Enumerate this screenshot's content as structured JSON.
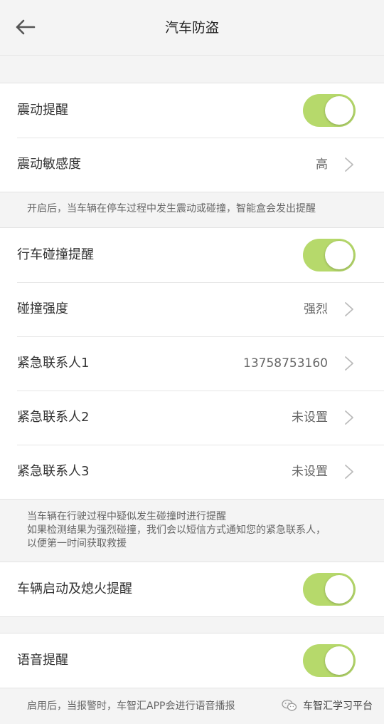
{
  "header": {
    "title": "汽车防盗"
  },
  "vibration_section": {
    "alert_label": "震动提醒",
    "alert_on": true,
    "sensitivity_label": "震动敏感度",
    "sensitivity_value": "高"
  },
  "vibration_note": "开启后，当车辆在停车过程中发生震动或碰撞，智能盒会发出提醒",
  "collision_section": {
    "alert_label": "行车碰撞提醒",
    "alert_on": true,
    "intensity_label": "碰撞强度",
    "intensity_value": "强烈",
    "contacts": [
      {
        "label": "紧急联系人1",
        "value": "13758753160"
      },
      {
        "label": "紧急联系人2",
        "value": "未设置"
      },
      {
        "label": "紧急联系人3",
        "value": "未设置"
      }
    ]
  },
  "collision_note": {
    "line1": "当车辆在行驶过程中疑似发生碰撞时进行提醒",
    "line2": "如果检测结果为强烈碰撞，我们会以短信方式通知您的紧急联系人，",
    "line3": "以便第一时间获取救援"
  },
  "ignition_section": {
    "label": "车辆启动及熄火提醒",
    "on": true
  },
  "voice_section": {
    "label": "语音提醒",
    "on": true
  },
  "voice_note": "启用后，当报警时，车智汇APP会进行语音播报",
  "watermark": {
    "text": "车智汇学习平台",
    "icon": "wechat-icon"
  },
  "colors": {
    "toggle_on": "#b6d96b",
    "background": "#f4f4f4",
    "card": "#ffffff"
  }
}
